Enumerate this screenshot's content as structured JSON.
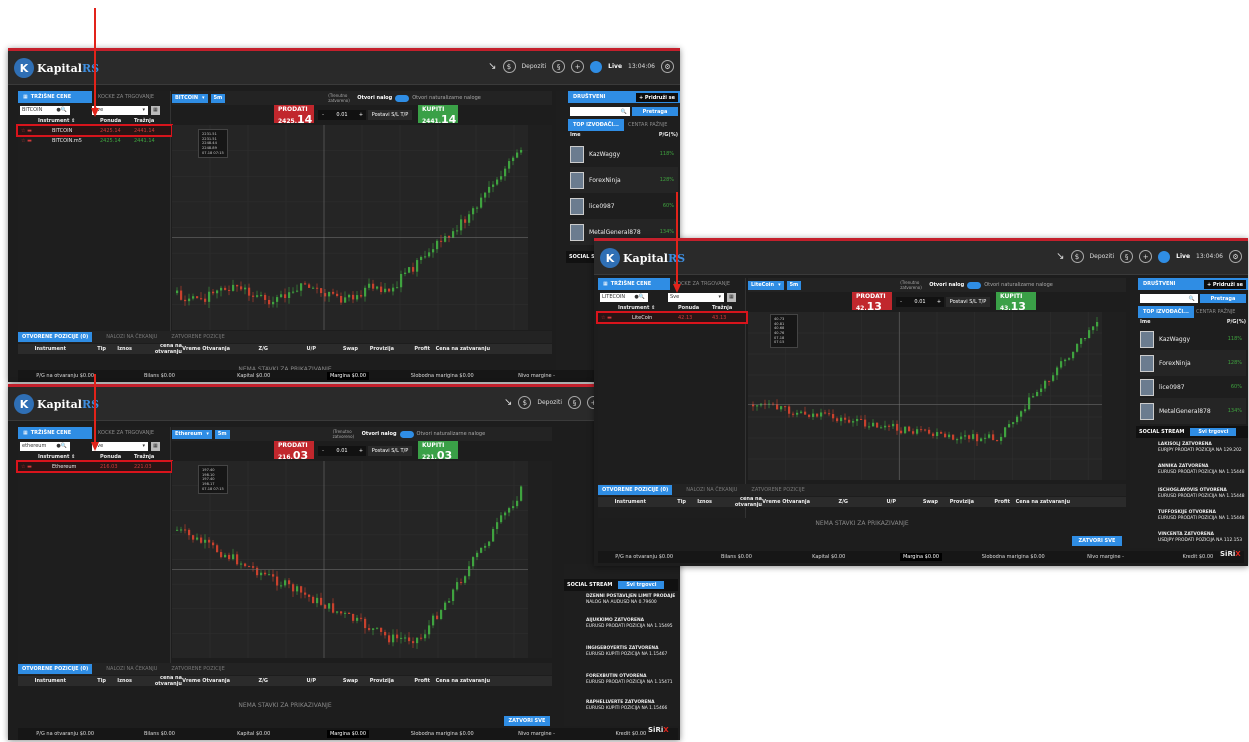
{
  "common": {
    "logo_text": "Kapital",
    "logo_text_suffix": "RS",
    "deposit": "Depoziti",
    "live": "Live",
    "panel_title": "TRŽIŠNE CENE",
    "panel_tab2": "KOCKE ZA TRGOVANJE",
    "filter_all": "Sve",
    "col_instrument": "Instrument ⇕",
    "col_bid": "Ponuda",
    "col_ask": "Tražnja",
    "period": "5m",
    "close_market": "(Trenutno zatvoreno)",
    "open_order": "Otvori nalog",
    "open_pending": "Otvori naturalizarne naloge",
    "sell": "PRODATI",
    "buy": "KUPITI",
    "qty": "0.01",
    "sltp": "Postavi S/L T/P",
    "tab_open": "OTVORENE POZICIJE (0)",
    "tab_pending": "NALOZI NA ČEKANJU",
    "tab_closed": "ZATVORENE POZICIJE",
    "table_headers": [
      "Instrument",
      "Tip",
      "Iznos",
      "cena na otvaranju",
      "Vreme Otvaranja",
      "Z/G",
      "U/P",
      "Swap",
      "Provizija",
      "Profit",
      "Cena na zatvaranju"
    ],
    "no_items": "NEMA STAVKI ZA PRIKAZIVANJE",
    "close_all": "ZATVORI SVE",
    "status": [
      "P/G na otvaranju $0.00",
      "Bilans $0.00",
      "Kapital $0.00",
      "Margina $0.00",
      "Slobodna marigina $0.00",
      "Nivo margine -",
      "Kredit $0.00"
    ],
    "social": "DRUŠTVENI",
    "join": "+ Pridruži se",
    "search_btn": "Pretraga",
    "top_traders": "TOP IZVOĐAČI...",
    "center": "CENTAR PAŽNJE",
    "col_name": "Ime",
    "col_pct": "P/G(%)",
    "social_stream": "SOCIAL STREAM",
    "all_traders": "Svi trgovci",
    "sirix_a": "SiRi",
    "sirix_b": "X",
    "time": "13:04:06"
  },
  "shots": [
    {
      "symbol": "BITCOIN",
      "search": "BITCOIN",
      "rows": [
        {
          "name": "BITCOIN",
          "bid": "2425.14",
          "ask": "2441.14"
        },
        {
          "name": "BITCOIN.m5",
          "bid": "2425.14",
          "ask": "2441.14"
        }
      ],
      "sell_main": "2425.",
      "sell_big": "14",
      "buy_main": "2441.",
      "buy_big": "14",
      "ohlc": [
        "2231.51",
        "2231.51",
        "2248.44",
        "2248.89",
        "07.18 07:15"
      ]
    },
    {
      "symbol": "Ethereum",
      "search": "ethereum",
      "rows": [
        {
          "name": "Ethereum",
          "bid": "216.03",
          "ask": "221.03"
        }
      ],
      "sell_main": "216.",
      "sell_big": "03",
      "buy_main": "221.",
      "buy_big": "03",
      "ohlc": [
        "197.40",
        "198.10",
        "197.40",
        "198.17",
        "07.18 07:15"
      ]
    },
    {
      "symbol": "LiteCoin",
      "search": "LITECOIN",
      "rows": [
        {
          "name": "LiteCoin",
          "bid": "42.13",
          "ask": "43.13"
        }
      ],
      "sell_main": "42.",
      "sell_big": "13",
      "buy_main": "43.",
      "buy_big": "13",
      "ohlc": [
        "40.73",
        "40.81",
        "40.68",
        "40.76",
        "07.18 07:15"
      ]
    }
  ],
  "traders": [
    {
      "name": "KazWaggy",
      "pct": "118%"
    },
    {
      "name": "ForexNinja",
      "pct": "128%"
    },
    {
      "name": "lice0987",
      "pct": "60%"
    },
    {
      "name": "MetalGeneral878",
      "pct": "134%"
    }
  ],
  "events": [
    {
      "l1": "LAKISOLJ ZATVORENA",
      "l2": "EURJPY PRODATI POZICIJA NA 129.202"
    },
    {
      "l1": "ANNIKA ZATVORENA",
      "l2": "EURUSD PRODATI POZICIJA NA 1.15448"
    },
    {
      "l1": "ISCHOGLAVOVIS OTVORENA",
      "l2": "EURUSD PRODATI POZICIJA NA 1.15448"
    },
    {
      "l1": "TUFFOSKIJE OTVORENA",
      "l2": "EURUSD PRODATI POZICIJA NA 1.15448"
    },
    {
      "l1": "VINCENTA ZATVORENA",
      "l2": "USDJPY PRODATI POZICIJA NA 112.153"
    }
  ],
  "events_b": [
    {
      "l1": "DZENNI POSTAVLJEN LIMIT PRODAJE",
      "l2": "NALOG NA AUDUSD NA 0.79600"
    },
    {
      "l1": "AIJUKKIMO ZATVORENA",
      "l2": "EURUSD PRODATI POZICIJA NA 1.15495"
    },
    {
      "l1": "INGIGEBOYERTIS ZATVORENA",
      "l2": "EURUSD KUPITI POZICIJA NA 1.15467"
    },
    {
      "l1": "FOREXBUTIN OTVORENA",
      "l2": "EURUSD PRODATI POZICIJA NA 1.15471"
    },
    {
      "l1": "RAPHELLVERTE ZATVORENA",
      "l2": "EURUSD KUPITI POZICIJA NA 1.15466"
    }
  ]
}
